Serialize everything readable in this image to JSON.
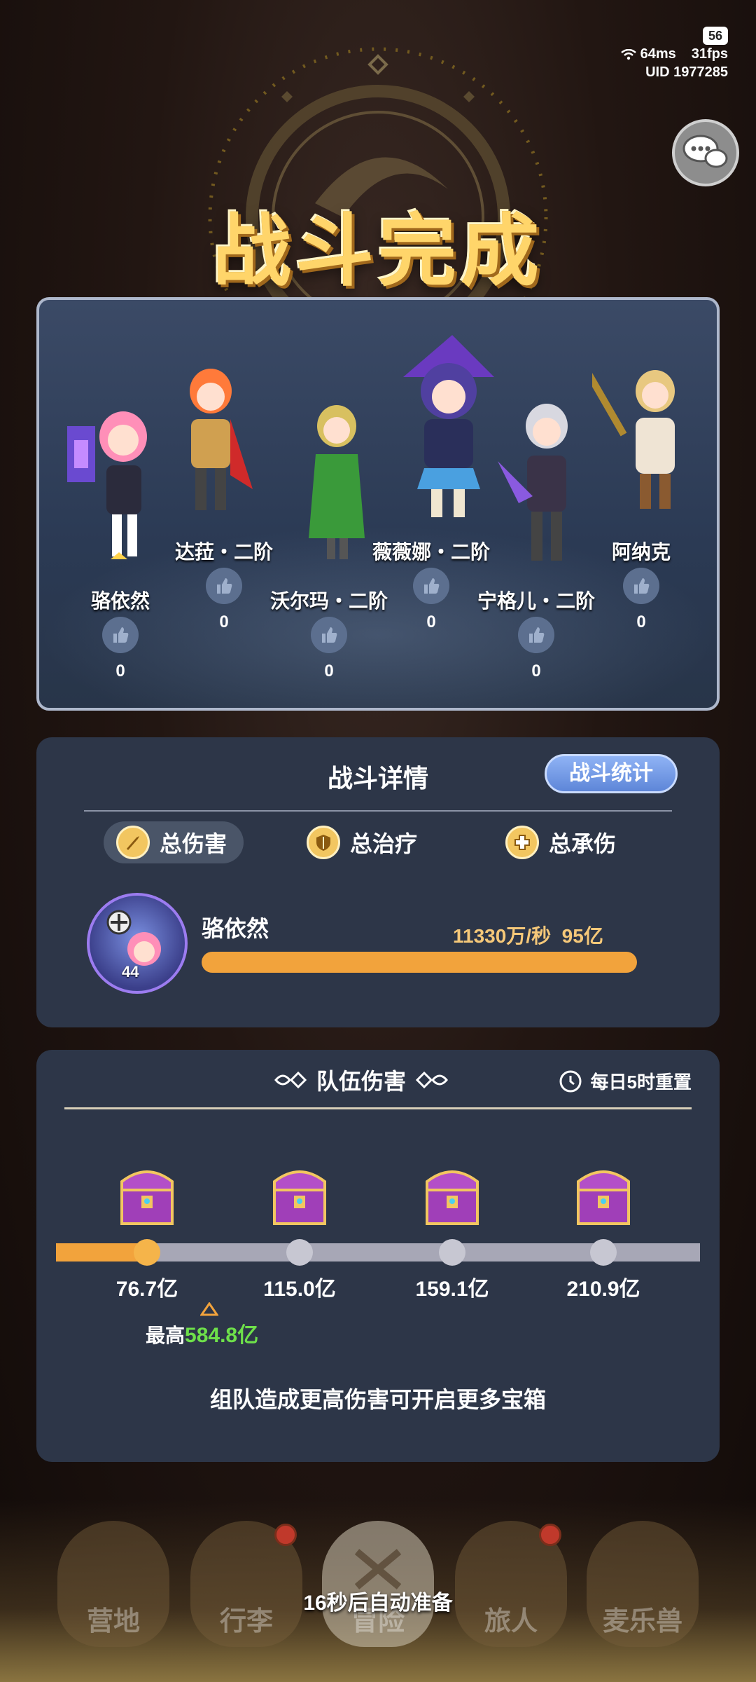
{
  "status": {
    "battery": "56",
    "ping": "64ms",
    "fps": "31fps",
    "uid_label": "UID",
    "uid": "1977285"
  },
  "title": "战斗完成",
  "heroes": [
    {
      "name": "骆依然",
      "likes": "0"
    },
    {
      "name": "达菈・二阶",
      "likes": "0"
    },
    {
      "name": "沃尔玛・二阶",
      "likes": "0"
    },
    {
      "name": "薇薇娜・二阶",
      "likes": "0"
    },
    {
      "name": "宁格儿・二阶",
      "likes": "0"
    },
    {
      "name": "阿纳克",
      "likes": "0"
    }
  ],
  "details": {
    "title": "战斗详情",
    "stats_button": "战斗统计",
    "tabs": [
      {
        "label": "总伤害",
        "icon": "sword-icon",
        "active": true
      },
      {
        "label": "总治疗",
        "icon": "shield-icon",
        "active": false
      },
      {
        "label": "总承伤",
        "icon": "cross-shield-icon",
        "active": false
      }
    ],
    "top": {
      "name": "骆依然",
      "level": "44",
      "rate": "11330万/秒",
      "total": "95亿",
      "bar_fraction": 1.0
    }
  },
  "team": {
    "title": "队伍伤害",
    "reset": "每日5时重置",
    "thresholds": [
      "76.7亿",
      "115.0亿",
      "159.1亿",
      "210.9亿"
    ],
    "progress_fraction": 0.155,
    "best_label": "最高",
    "best_value": "584.8亿",
    "tip": "组队造成更高伤害可开启更多宝箱"
  },
  "nav": [
    {
      "label": "营地",
      "badge": false
    },
    {
      "label": "行李",
      "badge": true
    },
    {
      "label": "冒险",
      "badge": false
    },
    {
      "label": "旅人",
      "badge": true
    },
    {
      "label": "麦乐兽",
      "badge": false
    }
  ],
  "auto_ready": "16秒后自动准备",
  "colors": {
    "accent": "#f2a33c",
    "title_gold": "#ffd56a",
    "best_green": "#6ee04a",
    "panel": "#2d3648"
  }
}
